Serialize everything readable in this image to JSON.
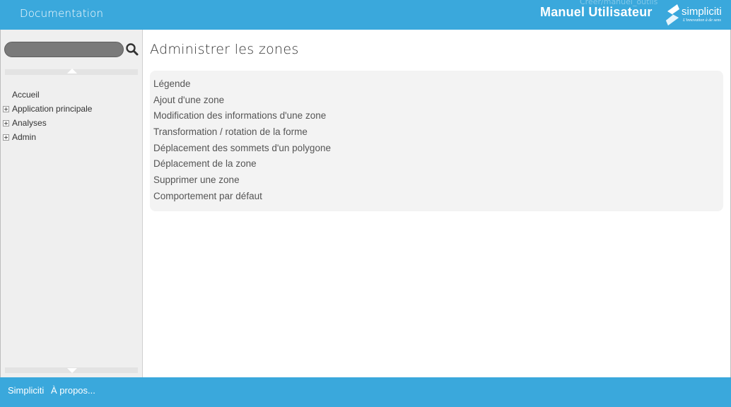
{
  "header": {
    "doc_title": "Documentation",
    "ghost_text": "Créer/manuel_outils",
    "manual_title": "Manuel Utilisateur",
    "logo": {
      "word": "simpliciti",
      "tagline": "L'innovation à de sens",
      "icon": "simpliciti-s-logo-icon"
    }
  },
  "sidebar": {
    "search": {
      "value": "",
      "placeholder": "",
      "icon": "search-icon"
    },
    "tree": [
      {
        "label": "Accueil",
        "expandable": false
      },
      {
        "label": "Application principale",
        "expandable": true
      },
      {
        "label": "Analyses",
        "expandable": true
      },
      {
        "label": "Admin",
        "expandable": true
      }
    ]
  },
  "main": {
    "title": "Administrer les zones",
    "toc": [
      "Légende",
      "Ajout d'une zone",
      "Modification des informations d'une zone",
      "Transformation / rotation de la forme",
      "Déplacement des sommets d'un polygone",
      "Déplacement de la zone",
      "Supprimer une zone",
      "Comportement par défaut"
    ]
  },
  "footer": {
    "brand_link": "Simpliciti",
    "about_link": "À propos..."
  },
  "colors": {
    "accent": "#3aa8dc",
    "sidebar_bg": "#efefef",
    "toc_bg": "#f3f3f3"
  }
}
